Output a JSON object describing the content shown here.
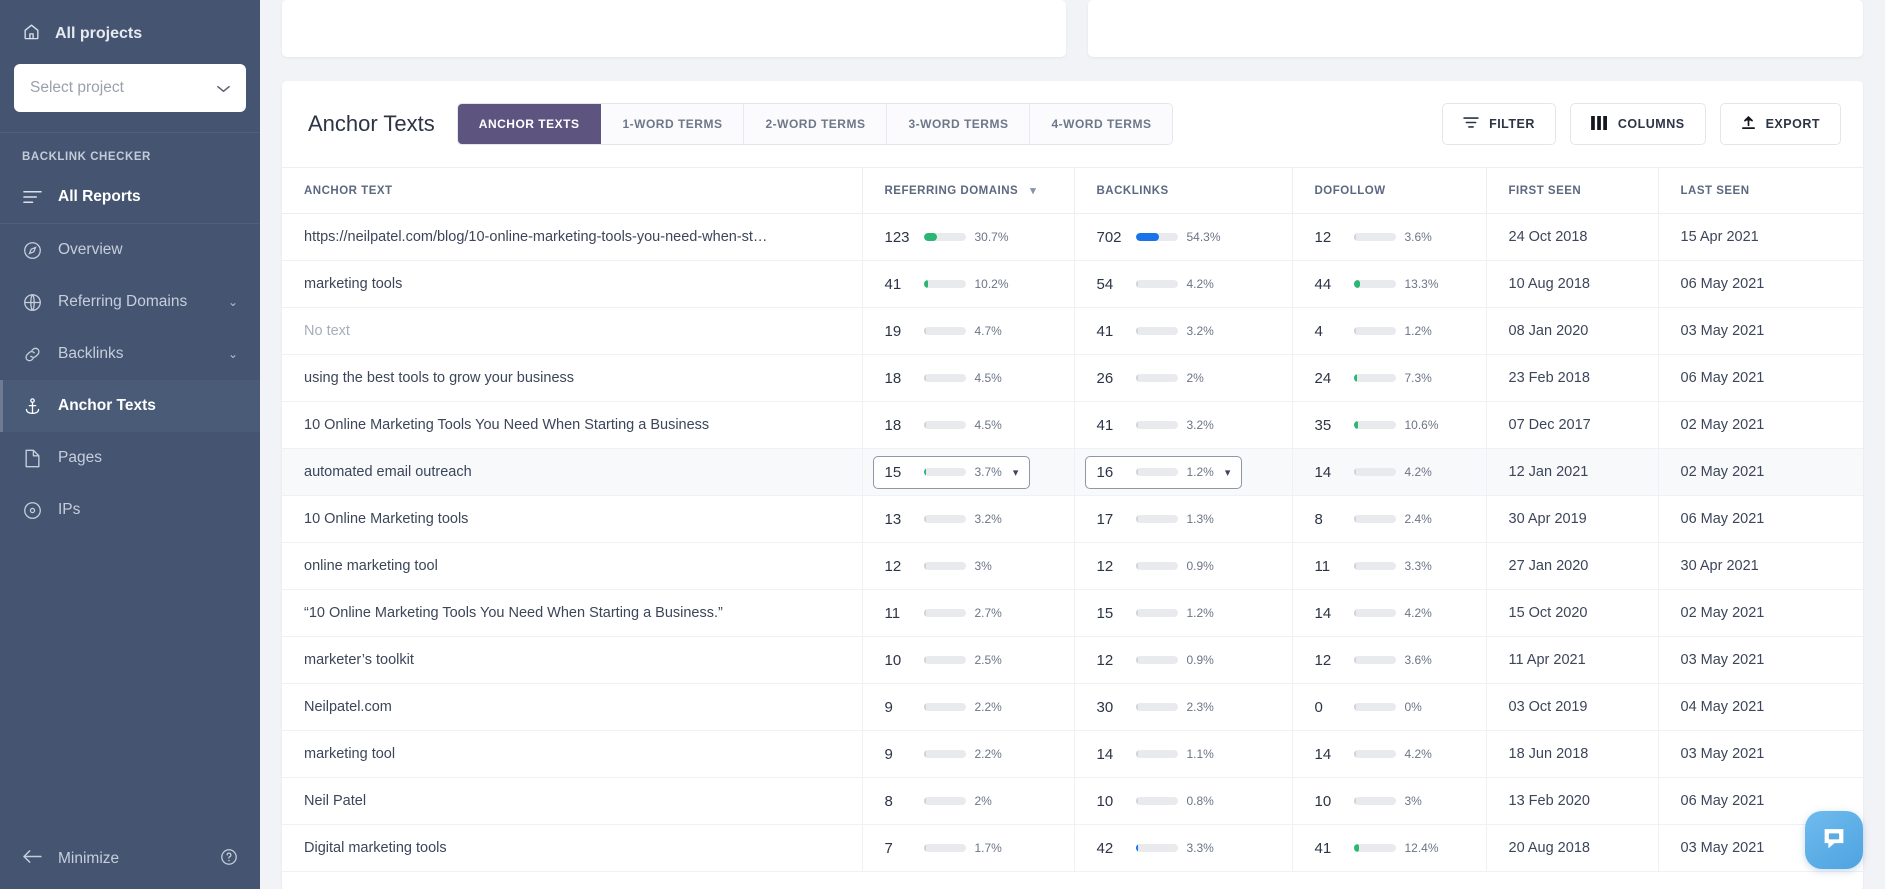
{
  "sidebar": {
    "all_projects_label": "All projects",
    "project_select_placeholder": "Select project",
    "section_label": "BACKLINK CHECKER",
    "items": [
      {
        "label": "All Reports",
        "icon": "list-icon",
        "caret": ""
      },
      {
        "label": "Overview",
        "icon": "compass-icon",
        "caret": ""
      },
      {
        "label": "Referring Domains",
        "icon": "globe-icon",
        "caret": "⌄"
      },
      {
        "label": "Backlinks",
        "icon": "link-icon",
        "caret": "⌄"
      },
      {
        "label": "Anchor Texts",
        "icon": "anchor-icon",
        "caret": ""
      },
      {
        "label": "Pages",
        "icon": "file-icon",
        "caret": ""
      },
      {
        "label": "IPs",
        "icon": "target-icon",
        "caret": ""
      }
    ],
    "minimize_label": "Minimize"
  },
  "header": {
    "title": "Anchor Texts",
    "tabs": [
      {
        "label": "ANCHOR TEXTS",
        "active": true
      },
      {
        "label": "1-WORD TERMS",
        "active": false
      },
      {
        "label": "2-WORD TERMS",
        "active": false
      },
      {
        "label": "3-WORD TERMS",
        "active": false
      },
      {
        "label": "4-WORD TERMS",
        "active": false
      }
    ],
    "actions": [
      {
        "label": "FILTER",
        "icon": "filter-icon"
      },
      {
        "label": "COLUMNS",
        "icon": "columns-icon"
      },
      {
        "label": "EXPORT",
        "icon": "upload-icon"
      }
    ]
  },
  "table": {
    "columns": [
      {
        "label": "ANCHOR TEXT",
        "sorted": false
      },
      {
        "label": "REFERRING DOMAINS",
        "sorted": true
      },
      {
        "label": "BACKLINKS",
        "sorted": false
      },
      {
        "label": "DOFOLLOW",
        "sorted": false
      },
      {
        "label": "FIRST SEEN",
        "sorted": false
      },
      {
        "label": "LAST SEEN",
        "sorted": false
      }
    ],
    "colors": {
      "bar_track": "#e9eaee",
      "bar_green": "#2bb673",
      "bar_blue": "#1a73e8",
      "accent_purple": "#5d5580"
    },
    "rows": [
      {
        "anchor": "https://neilpatel.com/blog/10-online-marketing-tools-you-need-when-st…",
        "muted": false,
        "selected": false,
        "rd": {
          "n": "123",
          "pct": "30.7%",
          "fill": 30.7,
          "color": "#2bb673"
        },
        "bl": {
          "n": "702",
          "pct": "54.3%",
          "fill": 54.3,
          "color": "#1a73e8"
        },
        "df": {
          "n": "12",
          "pct": "3.6%",
          "fill": 3.6,
          "color": "#cfd3da"
        },
        "first": "24 Oct 2018",
        "last": "15 Apr 2021"
      },
      {
        "anchor": "marketing tools",
        "muted": false,
        "selected": false,
        "rd": {
          "n": "41",
          "pct": "10.2%",
          "fill": 10.2,
          "color": "#2bb673"
        },
        "bl": {
          "n": "54",
          "pct": "4.2%",
          "fill": 4.2,
          "color": "#cfd3da"
        },
        "df": {
          "n": "44",
          "pct": "13.3%",
          "fill": 13.3,
          "color": "#2bb673"
        },
        "first": "10 Aug 2018",
        "last": "06 May 2021"
      },
      {
        "anchor": "No text",
        "muted": true,
        "selected": false,
        "rd": {
          "n": "19",
          "pct": "4.7%",
          "fill": 4.7,
          "color": "#cfd3da"
        },
        "bl": {
          "n": "41",
          "pct": "3.2%",
          "fill": 3.2,
          "color": "#cfd3da"
        },
        "df": {
          "n": "4",
          "pct": "1.2%",
          "fill": 1.2,
          "color": "#cfd3da"
        },
        "first": "08 Jan 2020",
        "last": "03 May 2021"
      },
      {
        "anchor": "using the best tools to grow your business",
        "muted": false,
        "selected": false,
        "rd": {
          "n": "18",
          "pct": "4.5%",
          "fill": 4.5,
          "color": "#cfd3da"
        },
        "bl": {
          "n": "26",
          "pct": "2%",
          "fill": 2,
          "color": "#cfd3da"
        },
        "df": {
          "n": "24",
          "pct": "7.3%",
          "fill": 7.3,
          "color": "#2bb673"
        },
        "first": "23 Feb 2018",
        "last": "06 May 2021"
      },
      {
        "anchor": "10 Online Marketing Tools You Need When Starting a Business",
        "muted": false,
        "selected": false,
        "rd": {
          "n": "18",
          "pct": "4.5%",
          "fill": 4.5,
          "color": "#cfd3da"
        },
        "bl": {
          "n": "41",
          "pct": "3.2%",
          "fill": 3.2,
          "color": "#cfd3da"
        },
        "df": {
          "n": "35",
          "pct": "10.6%",
          "fill": 10.6,
          "color": "#2bb673"
        },
        "first": "07 Dec 2017",
        "last": "02 May 2021"
      },
      {
        "anchor": "automated email outreach",
        "muted": false,
        "selected": true,
        "rd": {
          "n": "15",
          "pct": "3.7%",
          "fill": 3.7,
          "color": "#2bb673",
          "boxed": true
        },
        "bl": {
          "n": "16",
          "pct": "1.2%",
          "fill": 1.2,
          "color": "#cfd3da",
          "boxed": true
        },
        "df": {
          "n": "14",
          "pct": "4.2%",
          "fill": 4.2,
          "color": "#cfd3da"
        },
        "first": "12 Jan 2021",
        "last": "02 May 2021"
      },
      {
        "anchor": "10 Online Marketing tools",
        "muted": false,
        "selected": false,
        "rd": {
          "n": "13",
          "pct": "3.2%",
          "fill": 3.2,
          "color": "#cfd3da"
        },
        "bl": {
          "n": "17",
          "pct": "1.3%",
          "fill": 1.3,
          "color": "#cfd3da"
        },
        "df": {
          "n": "8",
          "pct": "2.4%",
          "fill": 2.4,
          "color": "#cfd3da"
        },
        "first": "30 Apr 2019",
        "last": "06 May 2021"
      },
      {
        "anchor": "online marketing tool",
        "muted": false,
        "selected": false,
        "rd": {
          "n": "12",
          "pct": "3%",
          "fill": 3,
          "color": "#cfd3da"
        },
        "bl": {
          "n": "12",
          "pct": "0.9%",
          "fill": 0.9,
          "color": "#cfd3da"
        },
        "df": {
          "n": "11",
          "pct": "3.3%",
          "fill": 3.3,
          "color": "#cfd3da"
        },
        "first": "27 Jan 2020",
        "last": "30 Apr 2021"
      },
      {
        "anchor": "“10 Online Marketing Tools You Need When Starting a Business.”",
        "muted": false,
        "selected": false,
        "rd": {
          "n": "11",
          "pct": "2.7%",
          "fill": 2.7,
          "color": "#cfd3da"
        },
        "bl": {
          "n": "15",
          "pct": "1.2%",
          "fill": 1.2,
          "color": "#cfd3da"
        },
        "df": {
          "n": "14",
          "pct": "4.2%",
          "fill": 4.2,
          "color": "#cfd3da"
        },
        "first": "15 Oct 2020",
        "last": "02 May 2021"
      },
      {
        "anchor": "marketer’s toolkit",
        "muted": false,
        "selected": false,
        "rd": {
          "n": "10",
          "pct": "2.5%",
          "fill": 2.5,
          "color": "#cfd3da"
        },
        "bl": {
          "n": "12",
          "pct": "0.9%",
          "fill": 0.9,
          "color": "#cfd3da"
        },
        "df": {
          "n": "12",
          "pct": "3.6%",
          "fill": 3.6,
          "color": "#cfd3da"
        },
        "first": "11 Apr 2021",
        "last": "03 May 2021"
      },
      {
        "anchor": "Neilpatel.com",
        "muted": false,
        "selected": false,
        "rd": {
          "n": "9",
          "pct": "2.2%",
          "fill": 2.2,
          "color": "#cfd3da"
        },
        "bl": {
          "n": "30",
          "pct": "2.3%",
          "fill": 2.3,
          "color": "#cfd3da"
        },
        "df": {
          "n": "0",
          "pct": "0%",
          "fill": 0,
          "color": "#cfd3da"
        },
        "first": "03 Oct 2019",
        "last": "04 May 2021"
      },
      {
        "anchor": "marketing tool",
        "muted": false,
        "selected": false,
        "rd": {
          "n": "9",
          "pct": "2.2%",
          "fill": 2.2,
          "color": "#cfd3da"
        },
        "bl": {
          "n": "14",
          "pct": "1.1%",
          "fill": 1.1,
          "color": "#cfd3da"
        },
        "df": {
          "n": "14",
          "pct": "4.2%",
          "fill": 4.2,
          "color": "#cfd3da"
        },
        "first": "18 Jun 2018",
        "last": "03 May 2021"
      },
      {
        "anchor": "Neil Patel",
        "muted": false,
        "selected": false,
        "rd": {
          "n": "8",
          "pct": "2%",
          "fill": 2,
          "color": "#cfd3da"
        },
        "bl": {
          "n": "10",
          "pct": "0.8%",
          "fill": 0.8,
          "color": "#cfd3da"
        },
        "df": {
          "n": "10",
          "pct": "3%",
          "fill": 3,
          "color": "#cfd3da"
        },
        "first": "13 Feb 2020",
        "last": "06 May 2021"
      },
      {
        "anchor": "Digital marketing tools",
        "muted": false,
        "selected": false,
        "rd": {
          "n": "7",
          "pct": "1.7%",
          "fill": 1.7,
          "color": "#cfd3da"
        },
        "bl": {
          "n": "42",
          "pct": "3.3%",
          "fill": 3.3,
          "color": "#1a73e8"
        },
        "df": {
          "n": "41",
          "pct": "12.4%",
          "fill": 12.4,
          "color": "#2bb673"
        },
        "first": "20 Aug 2018",
        "last": "03 May 2021"
      }
    ]
  },
  "chat": {
    "icon": "chat-bubble-icon"
  }
}
